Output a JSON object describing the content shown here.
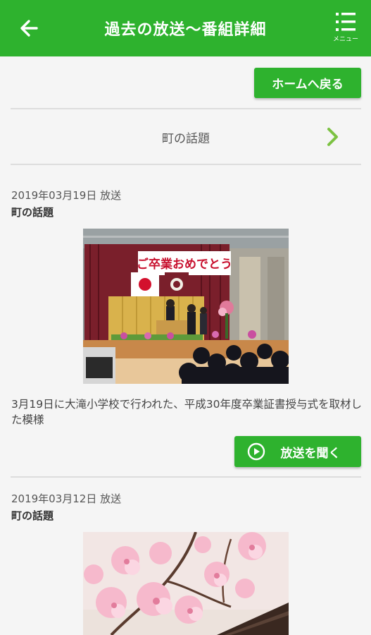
{
  "header": {
    "title": "過去の放送〜番組詳細",
    "menu_label": "メニュー",
    "back_icon": "arrow-left-icon",
    "menu_icon": "list-menu-icon",
    "bg_color": "#2eb22e"
  },
  "home_button": {
    "label": "ホームへ戻る"
  },
  "category": {
    "label": "町の話題",
    "icon": "chevron-right-icon",
    "icon_color": "#7cc242"
  },
  "entries": [
    {
      "date": "2019年03月19日 放送",
      "program": "町の話題",
      "description": "3月19日に大滝小学校で行われた、平成30年度卒業証書授与式を取材した模様",
      "banner_text": "ご卒業おめでとう",
      "listen_label": "放送を聞く",
      "listen_icon": "play-circle-icon"
    },
    {
      "date": "2019年03月12日 放送",
      "program": "町の話題"
    }
  ]
}
